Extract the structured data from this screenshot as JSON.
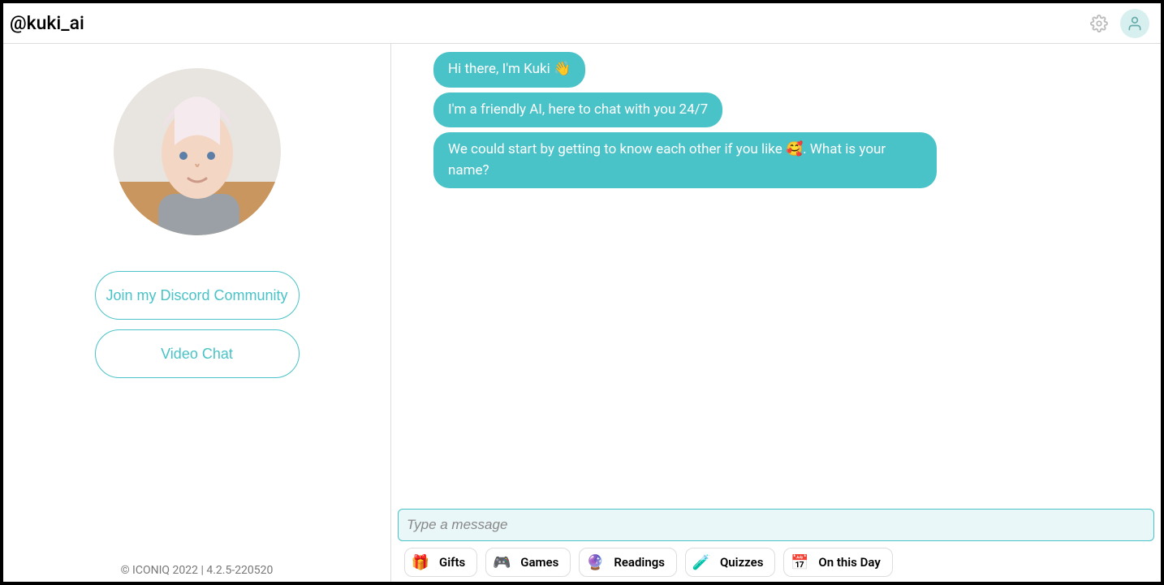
{
  "header": {
    "title": "@kuki_ai"
  },
  "sidebar": {
    "discord_label": "Join my Discord Community",
    "video_label": "Video Chat",
    "footer": "© ICONIQ 2022 | 4.2.5-220520"
  },
  "chat": {
    "messages": [
      {
        "text": "Hi there, I'm Kuki 👋",
        "show_avatar": false
      },
      {
        "text": "I'm a friendly AI, here to chat with you 24/7",
        "show_avatar": false
      },
      {
        "text": "We could start by getting to know each other if you like 🥰. What is your name?",
        "show_avatar": true
      }
    ],
    "input_placeholder": "Type a message"
  },
  "chips": [
    {
      "icon": "🎁",
      "label": "Gifts"
    },
    {
      "icon": "🎮",
      "label": "Games"
    },
    {
      "icon": "🔮",
      "label": "Readings"
    },
    {
      "icon": "🧪",
      "label": "Quizzes"
    },
    {
      "icon": "📅",
      "label": "On this Day"
    }
  ]
}
